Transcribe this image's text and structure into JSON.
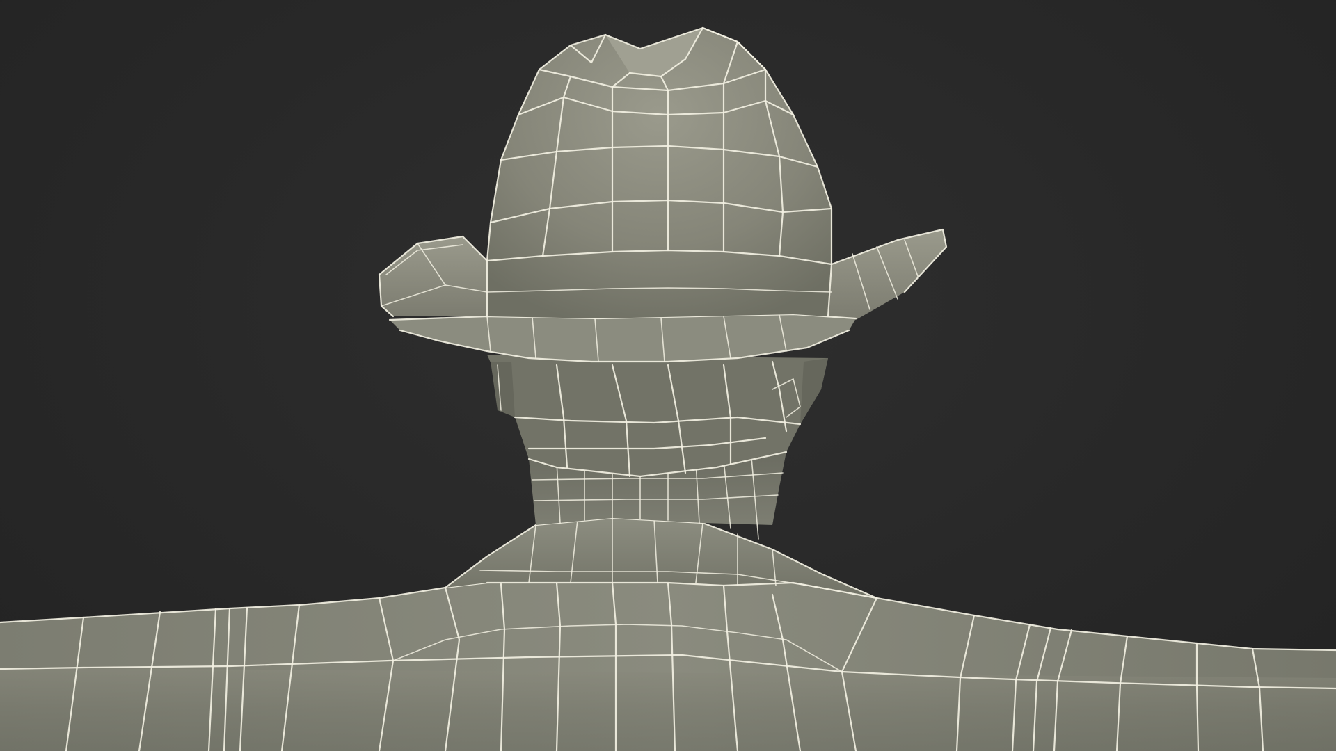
{
  "scene": {
    "subject": "wireframe-character-back-view",
    "colors": {
      "background": "#2a2a2a",
      "surface_light": "#8e8e80",
      "surface_mid": "#7a7b6e",
      "surface_dark": "#5e5f55",
      "wire": "#f2f0e2"
    }
  }
}
